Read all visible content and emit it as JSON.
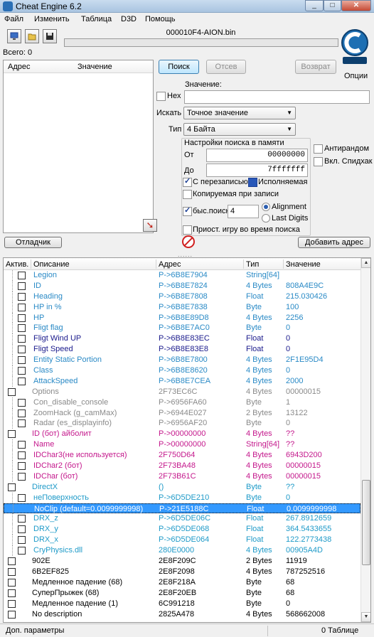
{
  "window": {
    "title": "Cheat Engine 6.2",
    "minimize": "_",
    "maximize": "□",
    "close": "✕"
  },
  "menu": [
    "Файл",
    "Изменить",
    "Таблица",
    "D3D",
    "Помощь"
  ],
  "toolbar": {
    "process_title": "000010F4-AION.bin"
  },
  "found_count": "Всего: 0",
  "results": {
    "col_address": "Адрес",
    "col_value": "Значение"
  },
  "scan": {
    "first_scan": "Поиск",
    "next_scan": "Отсев",
    "undo_scan": "Возврат",
    "options": "Опции",
    "value_label": "Значение:",
    "hex_label": "Hex",
    "hex_checked": false,
    "scan_type_label": "Искать",
    "scan_type": "Точное значение",
    "value_type_label": "Тип",
    "value_type": "4 Байта",
    "memory_title": "Настройки поиска в памяти",
    "from_label": "От",
    "from_value": "00000000",
    "to_label": "До",
    "to_value": "7fffffff",
    "writable": "С перезаписью",
    "executable": "Исполняемая",
    "copy_on_write": "Копируемая при записи",
    "fast_scan": "быс.поиск",
    "fast_scan_value": "4",
    "alignment": "Alignment",
    "last_digits": "Last Digits",
    "pause_game": "Приост. игру во время поиска",
    "unrandomizer": "Антирандом",
    "speedhack": "Вкл. Спидхак"
  },
  "buttons": {
    "debugger": "Отладчик",
    "add_address": "Добавить адрес"
  },
  "table": {
    "headers": [
      "Актив.",
      "Описание",
      "Адрес",
      "Тип",
      "Значение"
    ],
    "rows": [
      {
        "desc": "Legion",
        "addr": "P->6B8E7904",
        "type": "String[64]",
        "value": "",
        "indent": 1,
        "color": "#2a8ac6",
        "cb": true
      },
      {
        "desc": "ID",
        "addr": "P->6B8E7824",
        "type": "4 Bytes",
        "value": "808A4E9C",
        "indent": 1,
        "color": "#2a8ac6",
        "cb": true
      },
      {
        "desc": "Heading",
        "addr": "P->6B8E7808",
        "type": "Float",
        "value": "215.030426",
        "indent": 1,
        "color": "#2a8ac6",
        "cb": true
      },
      {
        "desc": "HP in %",
        "addr": "P->6B8E7838",
        "type": "Byte",
        "value": "100",
        "indent": 1,
        "color": "#2a8ac6",
        "cb": true
      },
      {
        "desc": "HP",
        "addr": "P->6B8E89D8",
        "type": "4 Bytes",
        "value": "2256",
        "indent": 1,
        "color": "#2a8ac6",
        "cb": true
      },
      {
        "desc": "Fligt flag",
        "addr": "P->6B8E7AC0",
        "type": "Byte",
        "value": "0",
        "indent": 1,
        "color": "#2a8ac6",
        "cb": true
      },
      {
        "desc": "Fligt Wind UP",
        "addr": "P->6B8E83EC",
        "type": "Float",
        "value": "0",
        "indent": 1,
        "color": "#1a1a8c",
        "cb": true
      },
      {
        "desc": "Fligt Speed",
        "addr": "P->6B8E83E8",
        "type": "Float",
        "value": "0",
        "indent": 1,
        "color": "#1a1a8c",
        "cb": true
      },
      {
        "desc": "Entity Static Portion",
        "addr": "P->6B8E7800",
        "type": "4 Bytes",
        "value": "2F1E95D4",
        "indent": 1,
        "color": "#2a8ac6",
        "cb": true
      },
      {
        "desc": "Class",
        "addr": "P->6B8E8620",
        "type": "4 Bytes",
        "value": "0",
        "indent": 1,
        "color": "#2a8ac6",
        "cb": true
      },
      {
        "desc": "AttackSpeed",
        "addr": "P->6B8E7CEA",
        "type": "4 Bytes",
        "value": "2000",
        "indent": 1,
        "color": "#2a8ac6",
        "cb": true
      },
      {
        "desc": "Options",
        "addr": "2F73EC6C",
        "type": "4 Bytes",
        "value": "00000015",
        "indent": 0,
        "color": "#8a8a8a",
        "cb": true
      },
      {
        "desc": "Con_disable_console",
        "addr": "P->6956FA60",
        "type": "Byte",
        "value": "1",
        "indent": 1,
        "color": "#8a8a8a",
        "cb": true
      },
      {
        "desc": "ZoomHack (g_camMax)",
        "addr": "P->6944E027",
        "type": "2 Bytes",
        "value": "13122",
        "indent": 1,
        "color": "#8a8a8a",
        "cb": true
      },
      {
        "desc": "Radar (es_displayinfo)",
        "addr": "P->6956AF20",
        "type": "Byte",
        "value": "0",
        "indent": 1,
        "color": "#8a8a8a",
        "cb": true
      },
      {
        "desc": "ID (бот) айболит",
        "addr": "P->00000000",
        "type": "4 Bytes",
        "value": "??",
        "indent": 0,
        "color": "#c4188c",
        "cb": true
      },
      {
        "desc": "Name",
        "addr": "P->00000000",
        "type": "String[64]",
        "value": "??",
        "indent": 1,
        "color": "#c4188c",
        "cb": true
      },
      {
        "desc": "IDChar3(не используется)",
        "addr": "2F750D64",
        "type": "4 Bytes",
        "value": "6943D200",
        "indent": 1,
        "color": "#c4188c",
        "cb": true
      },
      {
        "desc": "IDChar2 (бот)",
        "addr": "2F73BA48",
        "type": "4 Bytes",
        "value": "00000015",
        "indent": 1,
        "color": "#c4188c",
        "cb": true
      },
      {
        "desc": "IDChar (бот)",
        "addr": "2F73B61C",
        "type": "4 Bytes",
        "value": "00000015",
        "indent": 1,
        "color": "#c4188c",
        "cb": true
      },
      {
        "desc": "DirectX",
        "addr": "()",
        "type": "Byte",
        "value": "??",
        "indent": 0,
        "color": "#1e9ac8",
        "cb": true
      },
      {
        "desc": "неПоверхность",
        "addr": "P->6D5DE210",
        "type": "Byte",
        "value": "0",
        "indent": 1,
        "color": "#1e9ac8",
        "cb": true
      },
      {
        "desc": "NoClip (default=0.0099999998)",
        "addr": "P->21E5188C",
        "type": "Float",
        "value": "0.0099999998",
        "indent": 1,
        "color": "#1e9ac8",
        "cb": false,
        "selected": true
      },
      {
        "desc": "DRX_z",
        "addr": "P->6D5DE06C",
        "type": "Float",
        "value": "267.8912659",
        "indent": 1,
        "color": "#1e9ac8",
        "cb": true
      },
      {
        "desc": "DRX_y",
        "addr": "P->6D5DE068",
        "type": "Float",
        "value": "364.5433655",
        "indent": 1,
        "color": "#1e9ac8",
        "cb": true
      },
      {
        "desc": "DRX_x",
        "addr": "P->6D5DE064",
        "type": "Float",
        "value": "122.2773438",
        "indent": 1,
        "color": "#1e9ac8",
        "cb": true
      },
      {
        "desc": "CryPhysics.dll",
        "addr": "280E0000",
        "type": "4 Bytes",
        "value": "00905A4D",
        "indent": 1,
        "color": "#1e9ac8",
        "cb": true
      },
      {
        "desc": "902E",
        "addr": "2E8F209C",
        "type": "2 Bytes",
        "value": "11919",
        "indent": 0,
        "color": "#000000",
        "cb": true
      },
      {
        "desc": "6B2EF825",
        "addr": "2E8F2098",
        "type": "4 Bytes",
        "value": "787252516",
        "indent": 0,
        "color": "#000000",
        "cb": true
      },
      {
        "desc": "Медленное падение (68)",
        "addr": "2E8F218A",
        "type": "Byte",
        "value": "68",
        "indent": 0,
        "color": "#000000",
        "cb": true
      },
      {
        "desc": "СуперПрыжек (68)",
        "addr": "2E8F20EB",
        "type": "Byte",
        "value": "68",
        "indent": 0,
        "color": "#000000",
        "cb": true
      },
      {
        "desc": "Медленное падение (1)",
        "addr": "6C991218",
        "type": "Byte",
        "value": "0",
        "indent": 0,
        "color": "#000000",
        "cb": true
      },
      {
        "desc": "No description",
        "addr": "2825A478",
        "type": "4 Bytes",
        "value": "568662008",
        "indent": 0,
        "color": "#000000",
        "cb": true
      }
    ]
  },
  "status": {
    "left": "Доп. параметры",
    "right": "0 Таблице"
  }
}
